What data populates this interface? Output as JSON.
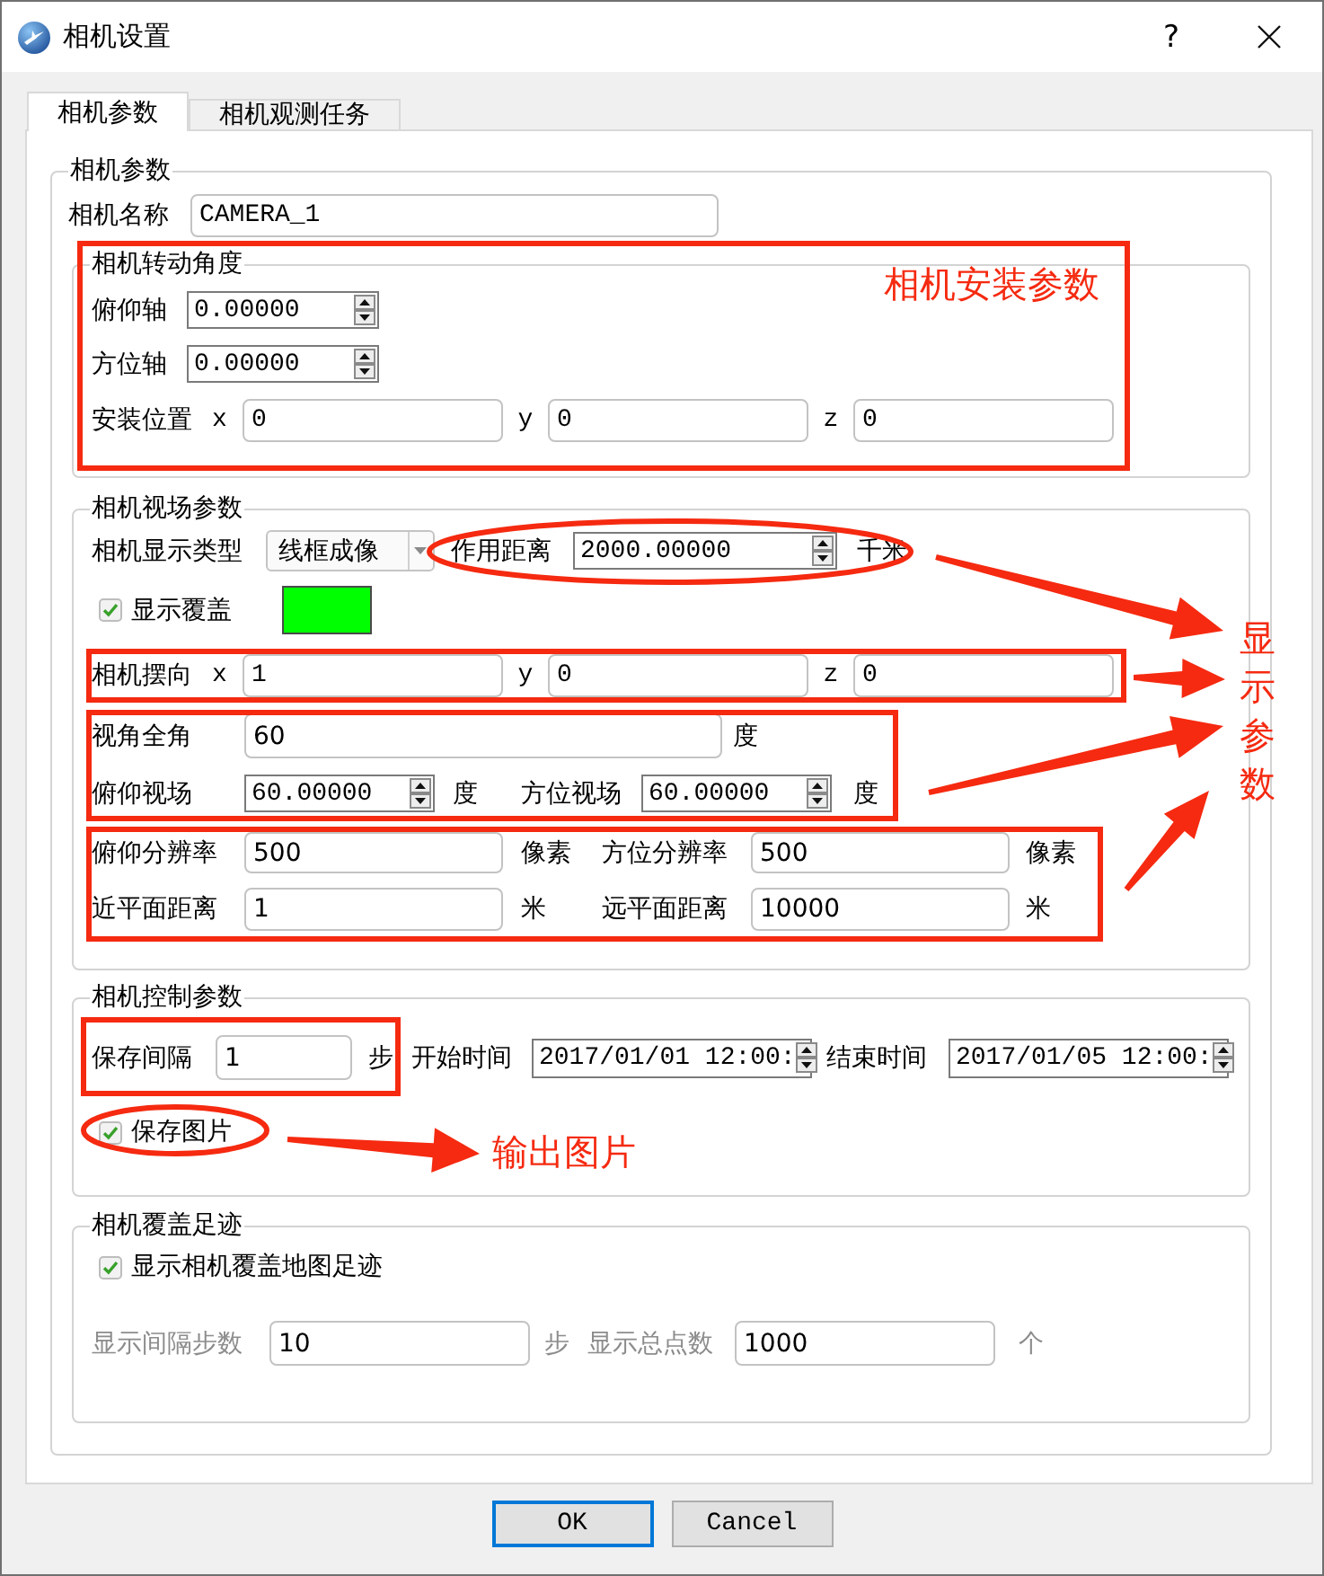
{
  "window": {
    "title": "相机设置",
    "help": "?"
  },
  "tabs": [
    {
      "label": "相机参数",
      "selected": true
    },
    {
      "label": "相机观测任务",
      "selected": false
    }
  ],
  "camera": {
    "title": "相机参数",
    "name": {
      "label": "相机名称",
      "value": "CAMERA_1"
    }
  },
  "rotation": {
    "title": "相机转动角度",
    "pitch": {
      "label": "俯仰轴",
      "value": "0.00000"
    },
    "azimuth": {
      "label": "方位轴",
      "value": "0.00000"
    },
    "position": {
      "label": "安装位置",
      "coords": [
        {
          "axis": "x",
          "value": "0"
        },
        {
          "axis": "y",
          "value": "0"
        },
        {
          "axis": "z",
          "value": "0"
        }
      ]
    }
  },
  "view": {
    "title": "相机视场参数",
    "display_type": {
      "label": "相机显示类型",
      "value": "线框成像"
    },
    "range": {
      "label": "作用距离",
      "value": "2000.00000",
      "unit": "千米"
    },
    "coverage": {
      "label": "显示覆盖",
      "checked": true,
      "color": "#00ff00"
    },
    "direction": {
      "label": "相机摆向",
      "coords": [
        {
          "axis": "x",
          "value": "1"
        },
        {
          "axis": "y",
          "value": "0"
        },
        {
          "axis": "z",
          "value": "0"
        }
      ]
    },
    "fov": {
      "label": "视角全角",
      "value": "60",
      "unit": "度"
    },
    "pitch_fov": {
      "label": "俯仰视场",
      "value": "60.00000",
      "unit": "度"
    },
    "azimuth_fov": {
      "label": "方位视场",
      "value": "60.00000",
      "unit": "度"
    },
    "pitch_res": {
      "label": "俯仰分辨率",
      "value": "500",
      "unit": "像素"
    },
    "azimuth_res": {
      "label": "方位分辨率",
      "value": "500",
      "unit": "像素"
    },
    "near": {
      "label": "近平面距离",
      "value": "1",
      "unit": "米"
    },
    "far": {
      "label": "远平面距离",
      "value": "10000",
      "unit": "米"
    }
  },
  "control": {
    "title": "相机控制参数",
    "interval": {
      "label": "保存间隔",
      "value": "1",
      "unit": "步"
    },
    "start": {
      "label": "开始时间",
      "value": "2017/01/01 12:00:"
    },
    "end": {
      "label": "结束时间",
      "value": "2017/01/05 12:00:"
    },
    "save_images": {
      "label": "保存图片",
      "checked": true
    }
  },
  "footprint": {
    "title": "相机覆盖足迹",
    "show": {
      "label": "显示相机覆盖地图足迹",
      "checked": true
    },
    "step": {
      "label": "显示间隔步数",
      "value": "10",
      "unit": "步",
      "disabled": true
    },
    "total": {
      "label": "显示总点数",
      "value": "1000",
      "unit": "个",
      "disabled": true
    }
  },
  "buttons": [
    {
      "label": "OK",
      "default": true
    },
    {
      "label": "Cancel",
      "default": false
    }
  ],
  "annotations": {
    "install": "相机安装参数",
    "display": "显示参数",
    "output": "输出图片"
  }
}
